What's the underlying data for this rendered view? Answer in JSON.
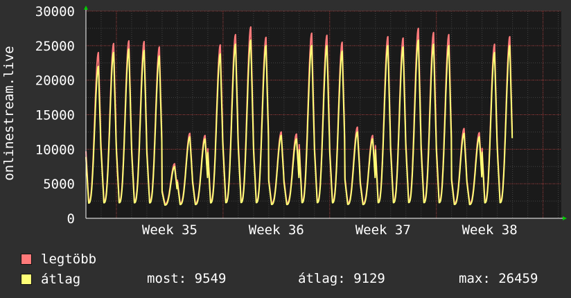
{
  "chart_data": {
    "type": "area",
    "ylabel": "onlinestream.live",
    "ylim": [
      0,
      30000
    ],
    "yticks": [
      0,
      5000,
      10000,
      15000,
      20000,
      25000,
      30000
    ],
    "xticks": [
      {
        "label": "Week 35",
        "day": 5.5
      },
      {
        "label": "Week 36",
        "day": 12.5
      },
      {
        "label": "Week 37",
        "day": 19.5
      },
      {
        "label": "Week 38",
        "day": 26.5
      }
    ],
    "x_range_days": [
      0,
      31.2
    ],
    "series": [
      {
        "name": "legtöbb",
        "color": "#ff7a7a",
        "daily_peaks": [
          24000,
          25300,
          25700,
          25600,
          24800,
          7900,
          12300,
          12000,
          25100,
          26600,
          27700,
          26200,
          12500,
          12200,
          26800,
          26500,
          25500,
          13200,
          12000,
          26300,
          26100,
          27500,
          26900,
          26600,
          13000,
          12400,
          25200,
          26300
        ]
      },
      {
        "name": "átlag",
        "color": "#ffff77",
        "daily_peaks": [
          22000,
          24000,
          24500,
          24300,
          23500,
          7500,
          11800,
          11500,
          23800,
          25200,
          25800,
          25000,
          12000,
          11500,
          25000,
          25000,
          24200,
          12500,
          11500,
          25000,
          24800,
          25800,
          25200,
          25000,
          12300,
          11800,
          24000,
          25000
        ]
      }
    ],
    "gaps_after_day": [
      5
    ],
    "grid": true
  },
  "legend": [
    {
      "label": "legtöbb",
      "color": "#ff7a7a"
    },
    {
      "label": "átlag",
      "color": "#ffff77"
    }
  ],
  "stats": {
    "most": "most: 9549",
    "atlag": "átlag: 9129",
    "max": "max: 26459"
  },
  "colors": {
    "background": "#2f2f2f",
    "plot_background": "#1a1a1a",
    "major_grid": "#8a2a2a",
    "minor_grid": "#444444",
    "axis_arrow": "#00cc00"
  }
}
